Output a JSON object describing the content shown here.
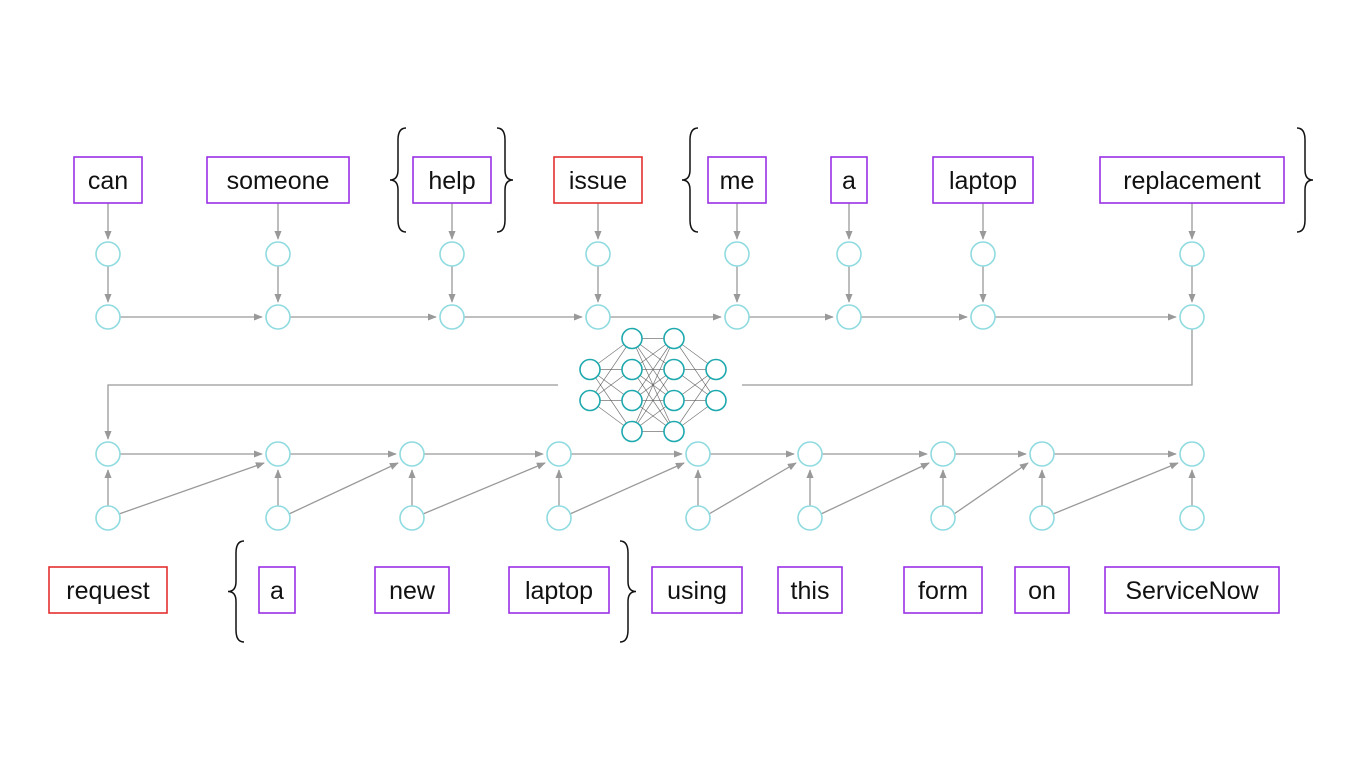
{
  "colors": {
    "background": "#ffffff",
    "token_border": "#9b30e6",
    "highlight_border": "#e53030",
    "node_stroke": "#8fdbe0",
    "nn_node_stroke": "#1ea9ae",
    "arrow": "#999999",
    "nn_edge": "#555555",
    "brace": "#111111"
  },
  "encoder": {
    "tokens": [
      {
        "text": "can",
        "highlight": false
      },
      {
        "text": "someone",
        "highlight": false
      },
      {
        "text": "help",
        "highlight": false
      },
      {
        "text": "issue",
        "highlight": true
      },
      {
        "text": "me",
        "highlight": false
      },
      {
        "text": "a",
        "highlight": false
      },
      {
        "text": "laptop",
        "highlight": false
      },
      {
        "text": "replacement",
        "highlight": false
      }
    ],
    "brace_groups": [
      {
        "from": 2,
        "to": 2
      },
      {
        "from": 4,
        "to": 7
      }
    ]
  },
  "decoder": {
    "tokens": [
      {
        "text": "request",
        "highlight": true
      },
      {
        "text": "a",
        "highlight": false
      },
      {
        "text": "new",
        "highlight": false
      },
      {
        "text": "laptop",
        "highlight": false
      },
      {
        "text": "using",
        "highlight": false
      },
      {
        "text": "this",
        "highlight": false
      },
      {
        "text": "form",
        "highlight": false
      },
      {
        "text": "on",
        "highlight": false
      },
      {
        "text": "ServiceNow",
        "highlight": false
      }
    ],
    "brace_groups": [
      {
        "from": 1,
        "to": 3
      }
    ],
    "diagonal_links": [
      [
        0,
        1
      ],
      [
        1,
        2
      ],
      [
        2,
        3
      ],
      [
        3,
        4
      ],
      [
        4,
        5
      ],
      [
        5,
        6
      ],
      [
        6,
        7
      ],
      [
        7,
        8
      ]
    ]
  },
  "neural_network": {
    "layers": [
      2,
      4,
      4,
      2
    ]
  }
}
